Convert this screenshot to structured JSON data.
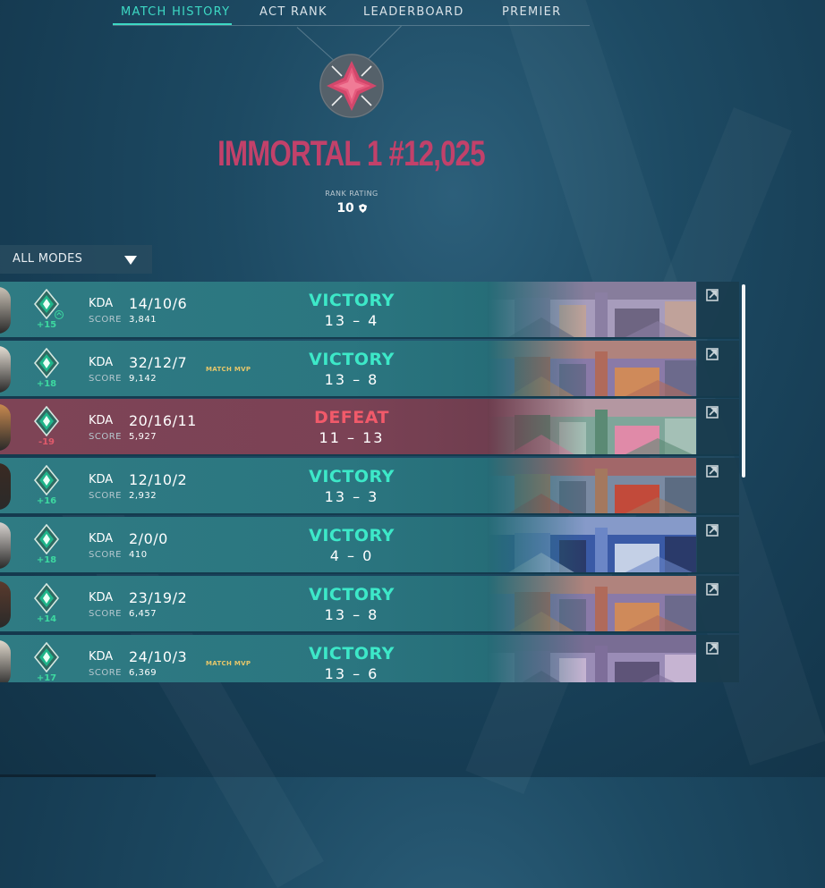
{
  "tabs": [
    {
      "label": "MATCH HISTORY",
      "active": true
    },
    {
      "label": "ACT RANK",
      "active": false
    },
    {
      "label": "LEADERBOARD",
      "active": false
    },
    {
      "label": "PREMIER",
      "active": false
    }
  ],
  "rank": {
    "icon": "immortal-rank-icon",
    "title": "IMMORTAL 1 #12,025",
    "rating_label": "RANK RATING",
    "rating_value": "10",
    "color": "#c2416a"
  },
  "filter": {
    "label": "ALL MODES"
  },
  "labels": {
    "kda": "KDA",
    "score": "SCORE"
  },
  "colors": {
    "victory": "#3de8c8",
    "defeat": "#f15a6a",
    "accent": "#3dd9c4",
    "mvp": "#e6c76a"
  },
  "matches": [
    {
      "result": "VICTORY",
      "win": true,
      "kda": "14/10/6",
      "score": "3,841",
      "rounds": "13 – 4",
      "rr_change": "+15",
      "mvp": "",
      "promoted": true,
      "map": "map-1"
    },
    {
      "result": "VICTORY",
      "win": true,
      "kda": "32/12/7",
      "score": "9,142",
      "rounds": "13 – 8",
      "rr_change": "+18",
      "mvp": "MATCH MVP",
      "promoted": false,
      "map": "map-2"
    },
    {
      "result": "DEFEAT",
      "win": false,
      "kda": "20/16/11",
      "score": "5,927",
      "rounds": "11 – 13",
      "rr_change": "-19",
      "mvp": "",
      "promoted": false,
      "map": "map-3"
    },
    {
      "result": "VICTORY",
      "win": true,
      "kda": "12/10/2",
      "score": "2,932",
      "rounds": "13 – 3",
      "rr_change": "+16",
      "mvp": "",
      "promoted": false,
      "map": "map-4"
    },
    {
      "result": "VICTORY",
      "win": true,
      "kda": "2/0/0",
      "score": "410",
      "rounds": "4 – 0",
      "rr_change": "+18",
      "mvp": "",
      "promoted": false,
      "map": "map-5"
    },
    {
      "result": "VICTORY",
      "win": true,
      "kda": "23/19/2",
      "score": "6,457",
      "rounds": "13 – 8",
      "rr_change": "+14",
      "mvp": "",
      "promoted": false,
      "map": "map-2"
    },
    {
      "result": "VICTORY",
      "win": true,
      "kda": "24/10/3",
      "score": "6,369",
      "rounds": "13 – 6",
      "rr_change": "+17",
      "mvp": "MATCH MVP",
      "promoted": false,
      "map": "map-6"
    }
  ]
}
